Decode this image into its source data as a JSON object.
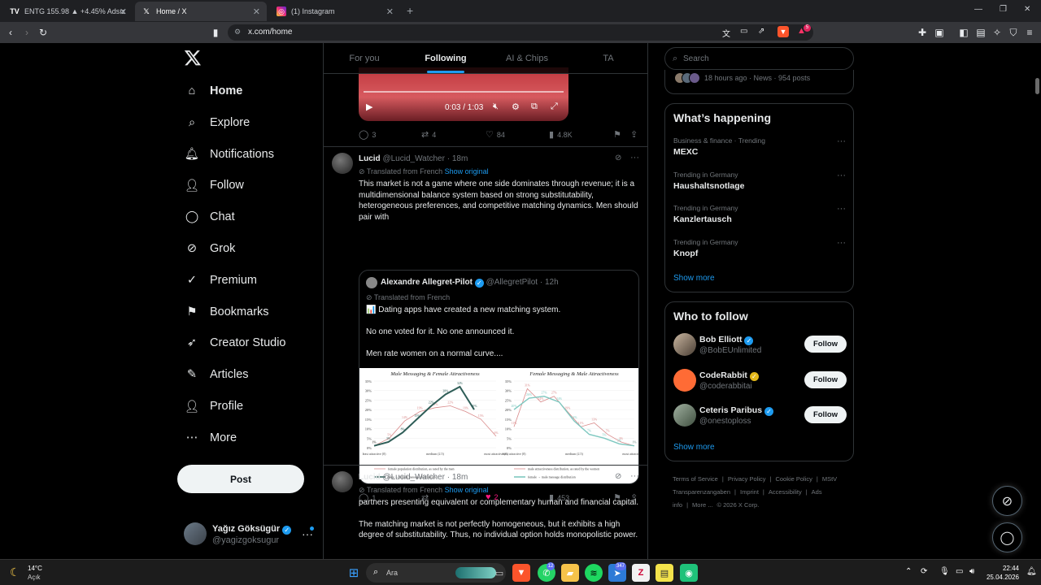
{
  "browser": {
    "tabs": [
      {
        "title": "ENTG 155.98 ▲ +4.45% Adsız",
        "favicon": "tradingview-icon"
      },
      {
        "title": "Home / X",
        "favicon": "x-icon"
      },
      {
        "title": "(1) Instagram",
        "favicon": "instagram-icon"
      }
    ],
    "url": "x.com/home",
    "extension_badge": "5"
  },
  "nav": {
    "items": [
      {
        "label": "Home",
        "icon": "home-icon"
      },
      {
        "label": "Explore",
        "icon": "search-icon"
      },
      {
        "label": "Notifications",
        "icon": "bell-icon"
      },
      {
        "label": "Follow",
        "icon": "add-person-icon"
      },
      {
        "label": "Chat",
        "icon": "chat-icon"
      },
      {
        "label": "Grok",
        "icon": "grok-icon"
      },
      {
        "label": "Premium",
        "icon": "premium-icon"
      },
      {
        "label": "Bookmarks",
        "icon": "bookmark-icon"
      },
      {
        "label": "Creator Studio",
        "icon": "rocket-icon"
      },
      {
        "label": "Articles",
        "icon": "articles-icon"
      },
      {
        "label": "Profile",
        "icon": "person-icon"
      },
      {
        "label": "More",
        "icon": "more-circle-icon"
      }
    ],
    "post_label": "Post",
    "account": {
      "name": "Yağız Göksügür",
      "handle": "@yagizgoksugur"
    }
  },
  "feed": {
    "tabs": [
      "For you",
      "Following",
      "AI & Chips",
      "TA"
    ],
    "active_tab": "Following",
    "video": {
      "time": "0:03 / 1:03"
    },
    "prev_post_actions": {
      "replies": "3",
      "reposts": "4",
      "likes": "84",
      "views": "4.8K"
    },
    "post1": {
      "name": "Lucid",
      "handle": "@Lucid_Watcher",
      "time": "18m",
      "translated": "Translated from French",
      "show_original": "Show original",
      "text": "This market is not a game where one side dominates through revenue; it is a multidimensional balance system based on strong substitutability, heterogeneous preferences, and competitive matching dynamics. Men should pair with",
      "quote": {
        "name": "Alexandre Allegret-Pilot",
        "handle": "@AllegretPilot",
        "time": "12h",
        "translated": "Translated from French",
        "lines": [
          "📊 Dating apps have created a new matching system.",
          "No one voted for it. No one announced it.",
          "Men rate women on a normal curve...."
        ]
      },
      "actions": {
        "replies": "1",
        "reposts": "",
        "likes": "2",
        "views": "453"
      }
    },
    "post2": {
      "name": "Lucid",
      "handle": "@Lucid_Watcher",
      "time": "18m",
      "translated": "Translated from French",
      "show_original": "Show original",
      "para1": "partners presenting equivalent or complementary human and financial capital.",
      "para2": "The matching market is not perfectly homogeneous, but it exhibits a high degree of substitutability. Thus, no individual option holds monopolistic power."
    }
  },
  "chart_data": [
    {
      "type": "line",
      "title": "Male Messaging & Female Attractiveness",
      "categories": [
        "least attractive (0)",
        "medium (2.5)",
        "most attractive (5)"
      ],
      "x": [
        0,
        0.5,
        1,
        1.5,
        2,
        2.5,
        3,
        3.5,
        4,
        4.5,
        5
      ],
      "ylim": [
        0,
        35
      ],
      "yticks": [
        "0%",
        "5%",
        "10%",
        "15%",
        "20%",
        "25%",
        "30%",
        "35%"
      ],
      "series": [
        {
          "name": "female population distribution, as rated by the men",
          "values": [
            1,
            5,
            14,
            19,
            21,
            22,
            19,
            15,
            6
          ],
          "color": "#d98a8a"
        },
        {
          "name": "male → female message distribution",
          "values": [
            1,
            3,
            8,
            15,
            22,
            28,
            32,
            20
          ],
          "color": "#2e5d57"
        }
      ],
      "data_labels": [
        "1%",
        "5%",
        "6%",
        "14%",
        "15%",
        "19%",
        "21%",
        "22%",
        "19%",
        "15%",
        "6%",
        "28%",
        "32%",
        "20%"
      ]
    },
    {
      "type": "line",
      "title": "Female Messaging & Male Attractiveness",
      "categories": [
        "least attractive (0)",
        "medium (2.5)",
        "most attractive (5)"
      ],
      "x": [
        0,
        0.5,
        1,
        1.5,
        2,
        2.5,
        3,
        3.5,
        4
      ],
      "ylim": [
        0,
        35
      ],
      "yticks": [
        "0%",
        "5%",
        "10%",
        "15%",
        "20%",
        "25%",
        "30%",
        "35%"
      ],
      "series": [
        {
          "name": "male attractiveness distribution, as rated by the women",
          "values": [
            11,
            31,
            24,
            27,
            19,
            11,
            13,
            7,
            3,
            1
          ],
          "color": "#d98a8a"
        },
        {
          "name": "female → male message distribution",
          "values": [
            20,
            26,
            27,
            24,
            14,
            7,
            5,
            2,
            1
          ],
          "color": "#7ec8c0"
        }
      ],
      "data_labels": [
        "31%",
        "26%",
        "27%",
        "24%",
        "19%",
        "11%",
        "13%",
        "7%",
        "3%",
        "1%",
        "1%"
      ]
    }
  ],
  "sidebar": {
    "search_placeholder": "Search",
    "news_meta": "18 hours ago · News · 954 posts",
    "happening_title": "What’s happening",
    "trends": [
      {
        "context": "Business & finance · Trending",
        "name": "MEXC"
      },
      {
        "context": "Trending in Germany",
        "name": "Haushaltsnotlage"
      },
      {
        "context": "Trending in Germany",
        "name": "Kanzlertausch"
      },
      {
        "context": "Trending in Germany",
        "name": "Knopf"
      }
    ],
    "show_more": "Show more",
    "who_title": "Who to follow",
    "who": [
      {
        "name": "Bob Elliott",
        "handle": "@BobEUnlimited",
        "badge": "blue"
      },
      {
        "name": "CodeRabbit",
        "handle": "@coderabbitai",
        "badge": "gold"
      },
      {
        "name": "Ceteris Paribus",
        "handle": "@onestoploss",
        "badge": "blue"
      }
    ],
    "follow_label": "Follow",
    "footer": [
      "Terms of Service",
      "|",
      "Privacy Policy",
      "|",
      "Cookie Policy",
      "|",
      "MStV Transparenzangaben",
      "|",
      "Imprint",
      "|",
      "Accessibility",
      "|",
      "Ads info",
      "|",
      "More ...",
      "© 2026 X Corp."
    ]
  },
  "taskbar": {
    "temp": "14°C",
    "condition": "Açık",
    "search": "Ara",
    "time": "22:44",
    "date": "25.04.2026",
    "badges": {
      "whatsapp": "12",
      "app": "347"
    }
  }
}
